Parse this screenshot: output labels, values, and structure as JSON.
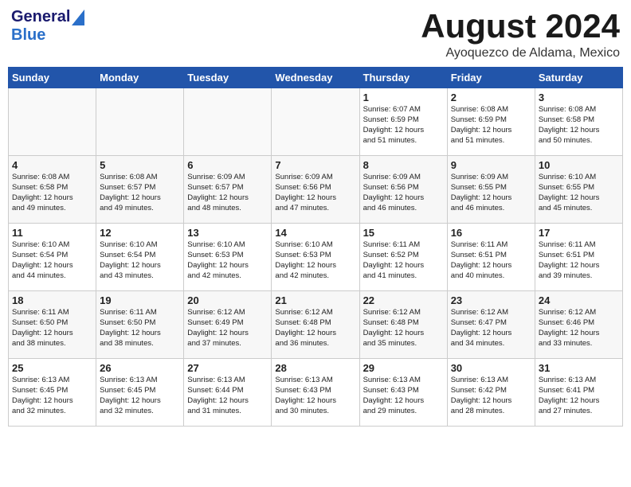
{
  "logo": {
    "general": "General",
    "blue": "Blue"
  },
  "title": "August 2024",
  "location": "Ayoquezco de Aldama, Mexico",
  "days_of_week": [
    "Sunday",
    "Monday",
    "Tuesday",
    "Wednesday",
    "Thursday",
    "Friday",
    "Saturday"
  ],
  "weeks": [
    [
      {
        "day": "",
        "info": ""
      },
      {
        "day": "",
        "info": ""
      },
      {
        "day": "",
        "info": ""
      },
      {
        "day": "",
        "info": ""
      },
      {
        "day": "1",
        "info": "Sunrise: 6:07 AM\nSunset: 6:59 PM\nDaylight: 12 hours\nand 51 minutes."
      },
      {
        "day": "2",
        "info": "Sunrise: 6:08 AM\nSunset: 6:59 PM\nDaylight: 12 hours\nand 51 minutes."
      },
      {
        "day": "3",
        "info": "Sunrise: 6:08 AM\nSunset: 6:58 PM\nDaylight: 12 hours\nand 50 minutes."
      }
    ],
    [
      {
        "day": "4",
        "info": "Sunrise: 6:08 AM\nSunset: 6:58 PM\nDaylight: 12 hours\nand 49 minutes."
      },
      {
        "day": "5",
        "info": "Sunrise: 6:08 AM\nSunset: 6:57 PM\nDaylight: 12 hours\nand 49 minutes."
      },
      {
        "day": "6",
        "info": "Sunrise: 6:09 AM\nSunset: 6:57 PM\nDaylight: 12 hours\nand 48 minutes."
      },
      {
        "day": "7",
        "info": "Sunrise: 6:09 AM\nSunset: 6:56 PM\nDaylight: 12 hours\nand 47 minutes."
      },
      {
        "day": "8",
        "info": "Sunrise: 6:09 AM\nSunset: 6:56 PM\nDaylight: 12 hours\nand 46 minutes."
      },
      {
        "day": "9",
        "info": "Sunrise: 6:09 AM\nSunset: 6:55 PM\nDaylight: 12 hours\nand 46 minutes."
      },
      {
        "day": "10",
        "info": "Sunrise: 6:10 AM\nSunset: 6:55 PM\nDaylight: 12 hours\nand 45 minutes."
      }
    ],
    [
      {
        "day": "11",
        "info": "Sunrise: 6:10 AM\nSunset: 6:54 PM\nDaylight: 12 hours\nand 44 minutes."
      },
      {
        "day": "12",
        "info": "Sunrise: 6:10 AM\nSunset: 6:54 PM\nDaylight: 12 hours\nand 43 minutes."
      },
      {
        "day": "13",
        "info": "Sunrise: 6:10 AM\nSunset: 6:53 PM\nDaylight: 12 hours\nand 42 minutes."
      },
      {
        "day": "14",
        "info": "Sunrise: 6:10 AM\nSunset: 6:53 PM\nDaylight: 12 hours\nand 42 minutes."
      },
      {
        "day": "15",
        "info": "Sunrise: 6:11 AM\nSunset: 6:52 PM\nDaylight: 12 hours\nand 41 minutes."
      },
      {
        "day": "16",
        "info": "Sunrise: 6:11 AM\nSunset: 6:51 PM\nDaylight: 12 hours\nand 40 minutes."
      },
      {
        "day": "17",
        "info": "Sunrise: 6:11 AM\nSunset: 6:51 PM\nDaylight: 12 hours\nand 39 minutes."
      }
    ],
    [
      {
        "day": "18",
        "info": "Sunrise: 6:11 AM\nSunset: 6:50 PM\nDaylight: 12 hours\nand 38 minutes."
      },
      {
        "day": "19",
        "info": "Sunrise: 6:11 AM\nSunset: 6:50 PM\nDaylight: 12 hours\nand 38 minutes."
      },
      {
        "day": "20",
        "info": "Sunrise: 6:12 AM\nSunset: 6:49 PM\nDaylight: 12 hours\nand 37 minutes."
      },
      {
        "day": "21",
        "info": "Sunrise: 6:12 AM\nSunset: 6:48 PM\nDaylight: 12 hours\nand 36 minutes."
      },
      {
        "day": "22",
        "info": "Sunrise: 6:12 AM\nSunset: 6:48 PM\nDaylight: 12 hours\nand 35 minutes."
      },
      {
        "day": "23",
        "info": "Sunrise: 6:12 AM\nSunset: 6:47 PM\nDaylight: 12 hours\nand 34 minutes."
      },
      {
        "day": "24",
        "info": "Sunrise: 6:12 AM\nSunset: 6:46 PM\nDaylight: 12 hours\nand 33 minutes."
      }
    ],
    [
      {
        "day": "25",
        "info": "Sunrise: 6:13 AM\nSunset: 6:45 PM\nDaylight: 12 hours\nand 32 minutes."
      },
      {
        "day": "26",
        "info": "Sunrise: 6:13 AM\nSunset: 6:45 PM\nDaylight: 12 hours\nand 32 minutes."
      },
      {
        "day": "27",
        "info": "Sunrise: 6:13 AM\nSunset: 6:44 PM\nDaylight: 12 hours\nand 31 minutes."
      },
      {
        "day": "28",
        "info": "Sunrise: 6:13 AM\nSunset: 6:43 PM\nDaylight: 12 hours\nand 30 minutes."
      },
      {
        "day": "29",
        "info": "Sunrise: 6:13 AM\nSunset: 6:43 PM\nDaylight: 12 hours\nand 29 minutes."
      },
      {
        "day": "30",
        "info": "Sunrise: 6:13 AM\nSunset: 6:42 PM\nDaylight: 12 hours\nand 28 minutes."
      },
      {
        "day": "31",
        "info": "Sunrise: 6:13 AM\nSunset: 6:41 PM\nDaylight: 12 hours\nand 27 minutes."
      }
    ]
  ]
}
